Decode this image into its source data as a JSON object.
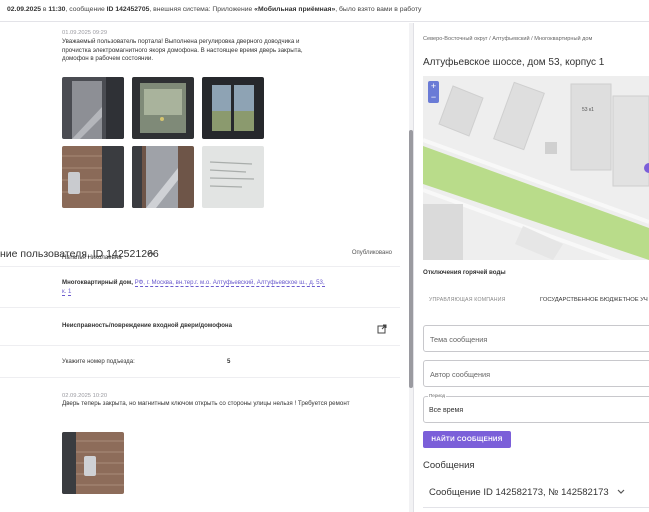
{
  "topbar": {
    "date_bold": "02.09.2025",
    "mid1": " в ",
    "time_bold": "11:30",
    "mid2": ", сообщение ",
    "id_bold": "ID 142452705",
    "mid3": ", внешняя система: Приложение ",
    "app_bold": "«Мобильная приёмная»",
    "tail": ", было взято вами в работу"
  },
  "left": {
    "first_message": {
      "date": "01.09.2025 09:29",
      "line1": "Уважаемый пользователь портала! Выполнена регулировка дверного доводчика и",
      "line2": "прочистка электромагнитного якоря домофона. В настоящее время дверь закрыта,",
      "line3": "домофон в рабочем состоянии."
    },
    "section": {
      "title": "ние пользователя, ID 142521266",
      "status": "Опубликовано"
    },
    "author": "Наталья Николаевна",
    "address_type": "Многоквартирный дом,",
    "address_link1": "РФ, г. Москва, вн.тер.г. м.о. Алтуфьевский, Алтуфьевское ш., д. 53,",
    "address_link2": "к. 1",
    "problem": "Неисправность/повреждение входной двери/домофона",
    "entrance_label": "Укажите номер подъезда:",
    "entrance_value": "5",
    "second_message": {
      "date": "02.09.2025 10:20",
      "text": "Дверь теперь закрыта, но магнитным ключом открыть со стороны улицы нельзя ! Требуется ремонт"
    }
  },
  "right": {
    "breadcrumb": "Северо-Восточный округ / Алтуфьевский / Многоквартирный дом",
    "address_title": "Алтуфьевское шоссе, дом 53, корпус 1",
    "map": {
      "zoom_in": "+",
      "zoom_out": "−",
      "building_label": "53 к1"
    },
    "outage_title": "Отключения горячей воды",
    "mgmt_label": "УПРАВЛЯЮЩАЯ КОМПАНИЯ",
    "mgmt_value": "ГОСУДАРСТВЕННОЕ БЮДЖЕТНОЕ УЧ",
    "subject_placeholder": "Тема сообщения",
    "author_placeholder": "Автор сообщения",
    "period_label": "Период",
    "period_value": "Все время",
    "find_button": "НАЙТИ СООБЩЕНИЯ",
    "messages_heading": "Сообщения",
    "message_item": "Сообщение ID 142582173, № 142582173"
  },
  "colors": {
    "accent": "#7b5fd9",
    "link": "#6a5acd",
    "map_road": "#b9dc8a"
  }
}
